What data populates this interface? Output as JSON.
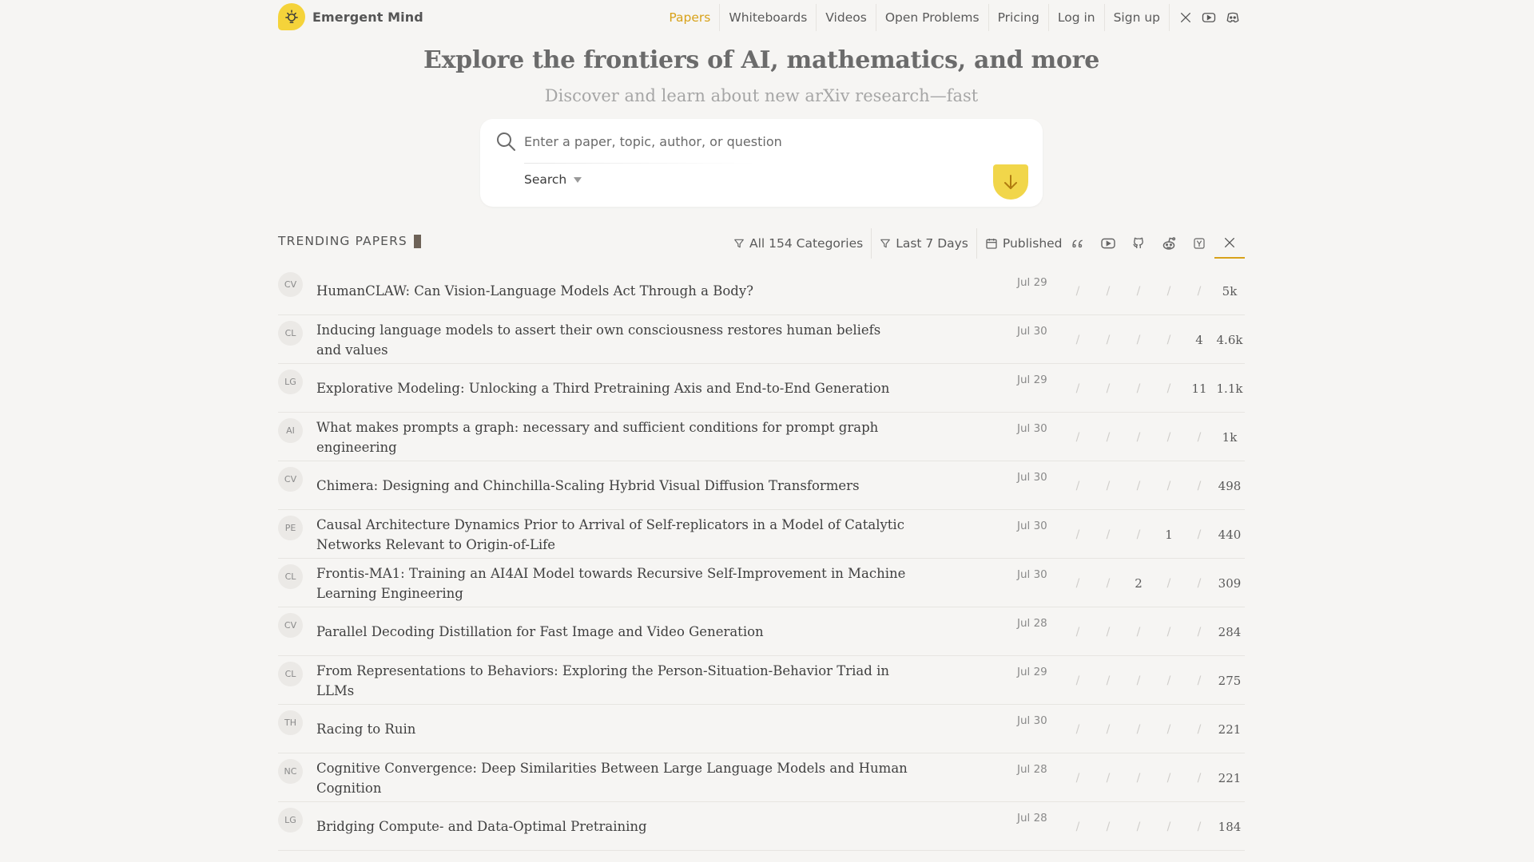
{
  "brand": {
    "name": "Emergent Mind",
    "accent": "#d8a21a",
    "logo_bg": "#f5d33a"
  },
  "nav": {
    "items": [
      {
        "label": "Papers",
        "active": true
      },
      {
        "label": "Whiteboards"
      },
      {
        "label": "Videos"
      },
      {
        "label": "Open Problems"
      },
      {
        "label": "Pricing"
      },
      {
        "label": "Log in"
      },
      {
        "label": "Sign up"
      }
    ],
    "icons": [
      "x-icon",
      "youtube-icon",
      "discord-icon"
    ]
  },
  "hero": {
    "title": "Explore the frontiers of AI, mathematics, and more",
    "subtitle": "Discover and learn about new arXiv research—fast"
  },
  "search": {
    "placeholder": "Enter a paper, topic, author, or question",
    "mode": "Search",
    "submit_icon": "arrow-down-icon"
  },
  "trending": {
    "title": "TRENDING PAPERS",
    "filters": {
      "categories": "All 154 Categories",
      "range": "Last 7 Days",
      "date_type": "Published"
    },
    "source_tabs": [
      "quote-icon",
      "youtube-icon",
      "github-icon",
      "reddit-icon",
      "hacker-news-icon",
      "x-icon"
    ],
    "active_source": "x-icon"
  },
  "papers": [
    {
      "cat": "CV",
      "title": "HumanCLAW: Can Vision-Language Models Act Through a Body?",
      "date": "Jul 29",
      "metrics": [
        "/",
        "/",
        "/",
        "/",
        "/"
      ],
      "x": "5k"
    },
    {
      "cat": "CL",
      "title": "Inducing language models to assert their own consciousness restores human beliefs and values",
      "date": "Jul 30",
      "metrics": [
        "/",
        "/",
        "/",
        "/",
        "4"
      ],
      "x": "4.6k"
    },
    {
      "cat": "LG",
      "title": "Explorative Modeling: Unlocking a Third Pretraining Axis and End-to-End Generation",
      "date": "Jul 29",
      "metrics": [
        "/",
        "/",
        "/",
        "/",
        "11"
      ],
      "x": "1.1k"
    },
    {
      "cat": "AI",
      "title": "What makes prompts a graph: necessary and sufficient conditions for prompt graph engineering",
      "date": "Jul 30",
      "metrics": [
        "/",
        "/",
        "/",
        "/",
        "/"
      ],
      "x": "1k"
    },
    {
      "cat": "CV",
      "title": "Chimera: Designing and Chinchilla-Scaling Hybrid Visual Diffusion Transformers",
      "date": "Jul 30",
      "metrics": [
        "/",
        "/",
        "/",
        "/",
        "/"
      ],
      "x": "498"
    },
    {
      "cat": "PE",
      "title": "Causal Architecture Dynamics Prior to Arrival of Self-replicators in a Model of Catalytic Networks Relevant to Origin-of-Life",
      "date": "Jul 30",
      "metrics": [
        "/",
        "/",
        "/",
        "1",
        "/"
      ],
      "x": "440"
    },
    {
      "cat": "CL",
      "title": "Frontis-MA1: Training an AI4AI Model towards Recursive Self-Improvement in Machine Learning Engineering",
      "date": "Jul 30",
      "metrics": [
        "/",
        "/",
        "2",
        "/",
        "/"
      ],
      "x": "309"
    },
    {
      "cat": "CV",
      "title": "Parallel Decoding Distillation for Fast Image and Video Generation",
      "date": "Jul 28",
      "metrics": [
        "/",
        "/",
        "/",
        "/",
        "/"
      ],
      "x": "284"
    },
    {
      "cat": "CL",
      "title": "From Representations to Behaviors: Exploring the Person-Situation-Behavior Triad in LLMs",
      "date": "Jul 29",
      "metrics": [
        "/",
        "/",
        "/",
        "/",
        "/"
      ],
      "x": "275"
    },
    {
      "cat": "TH",
      "title": "Racing to Ruin",
      "date": "Jul 30",
      "metrics": [
        "/",
        "/",
        "/",
        "/",
        "/"
      ],
      "x": "221"
    },
    {
      "cat": "NC",
      "title": "Cognitive Convergence: Deep Similarities Between Large Language Models and Human Cognition",
      "date": "Jul 28",
      "metrics": [
        "/",
        "/",
        "/",
        "/",
        "/"
      ],
      "x": "221"
    },
    {
      "cat": "LG",
      "title": "Bridging Compute- and Data-Optimal Pretraining",
      "date": "Jul 28",
      "metrics": [
        "/",
        "/",
        "/",
        "/",
        "/"
      ],
      "x": "184"
    }
  ]
}
